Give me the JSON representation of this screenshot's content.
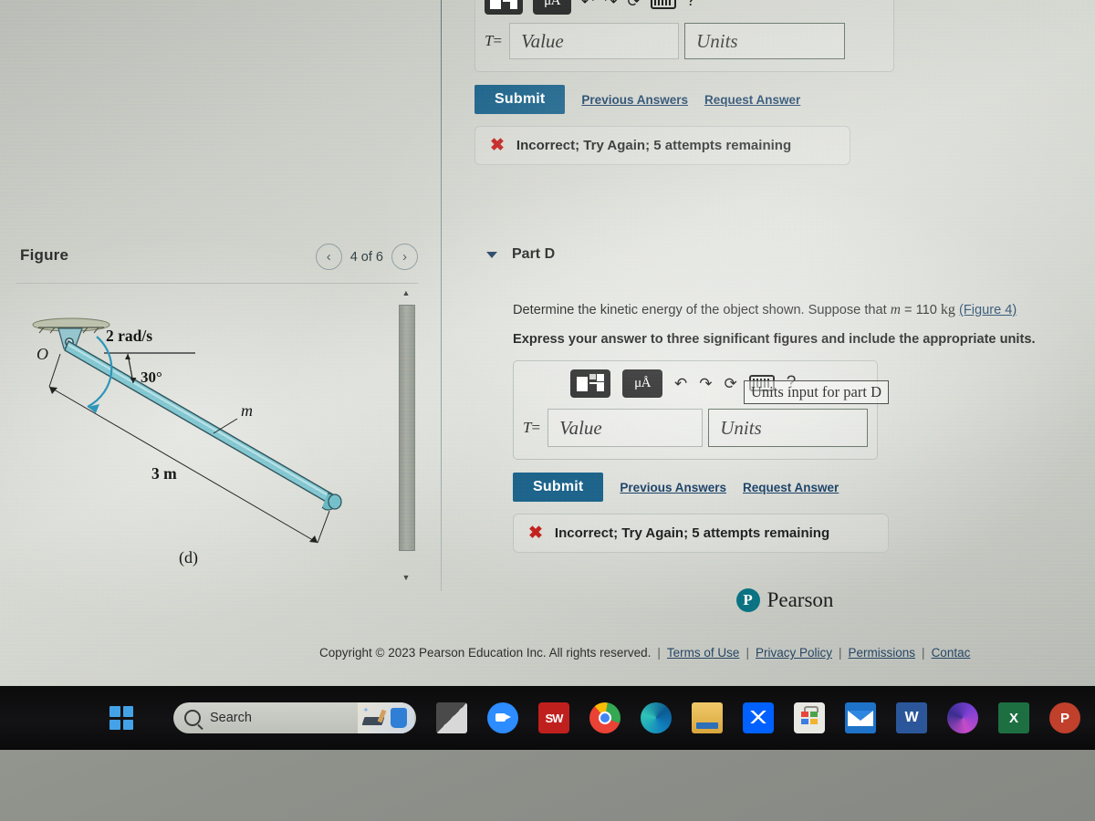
{
  "figure_panel": {
    "title": "Figure",
    "nav": {
      "prev": "‹",
      "next": "›",
      "counter": "4 of 6"
    },
    "diagram": {
      "origin_label": "O",
      "angular_velocity": "2 rad/s",
      "angle": "30°",
      "mass_label": "m",
      "length": "3 m",
      "caption": "(d)",
      "rod_color": "#7ec4cf"
    }
  },
  "part_c": {
    "toolbar": {
      "template": "math-template-icon",
      "units": "μÅ",
      "undo": "↶",
      "redo": "↷",
      "reset": "⟳",
      "keyboard": "keyboard-icon",
      "help": "?"
    },
    "lhs": "T",
    "equals": "=",
    "value_placeholder": "Value",
    "units_placeholder": "Units",
    "submit_label": "Submit",
    "previous_answers_label": "Previous Answers",
    "request_answer_label": "Request Answer",
    "feedback": {
      "mark": "✖",
      "text": "Incorrect; Try Again; 5 attempts remaining"
    }
  },
  "part_d": {
    "caret": "collapse-caret",
    "title": "Part D",
    "prompt_before": "Determine the kinetic energy of the object shown. Suppose that ",
    "prompt_var": "m",
    "prompt_eq": " = 110",
    "prompt_units": "kg",
    "figure_link": "(Figure 4)",
    "instruction": "Express your answer to three significant figures and include the appropriate units.",
    "toolbar": {
      "template": "math-template-icon",
      "units": "μÅ",
      "undo": "↶",
      "redo": "↷",
      "reset": "⟳",
      "keyboard": "keyboard-icon",
      "help": "?"
    },
    "lhs": "T",
    "equals": "=",
    "value_placeholder": "Value",
    "units_placeholder": "Units",
    "tooltip": "Units input for part D",
    "submit_label": "Submit",
    "previous_answers_label": "Previous Answers",
    "request_answer_label": "Request Answer",
    "feedback": {
      "mark": "✖",
      "text": "Incorrect; Try Again; 5 attempts remaining"
    }
  },
  "footer": {
    "brand_mark": "P",
    "brand_name": "Pearson",
    "copyright": "Copyright © 2023 Pearson Education Inc. All rights reserved.",
    "sep": "|",
    "links": [
      "Terms of Use",
      "Privacy Policy",
      "Permissions",
      "Contac"
    ]
  },
  "taskbar": {
    "start": "windows-start-icon",
    "search": {
      "icon": "search-icon",
      "placeholder": "Search"
    },
    "items": [
      {
        "name": "task-view",
        "label": ""
      },
      {
        "name": "zoom",
        "label": ""
      },
      {
        "name": "smartwork",
        "label": "SW"
      },
      {
        "name": "chrome",
        "label": ""
      },
      {
        "name": "edge",
        "label": ""
      },
      {
        "name": "file-explorer",
        "label": ""
      },
      {
        "name": "dropbox",
        "label": ""
      },
      {
        "name": "microsoft-store",
        "label": ""
      },
      {
        "name": "mail",
        "label": ""
      },
      {
        "name": "word",
        "label": "W"
      },
      {
        "name": "microsoft-365",
        "label": ""
      },
      {
        "name": "excel",
        "label": "X"
      },
      {
        "name": "powerpoint",
        "label": "P"
      }
    ]
  },
  "colors": {
    "submit_blue": "#1c5e84",
    "link_blue": "#1c3f63",
    "error_red": "#c0201d",
    "pearson_teal": "#0a6b7b"
  }
}
